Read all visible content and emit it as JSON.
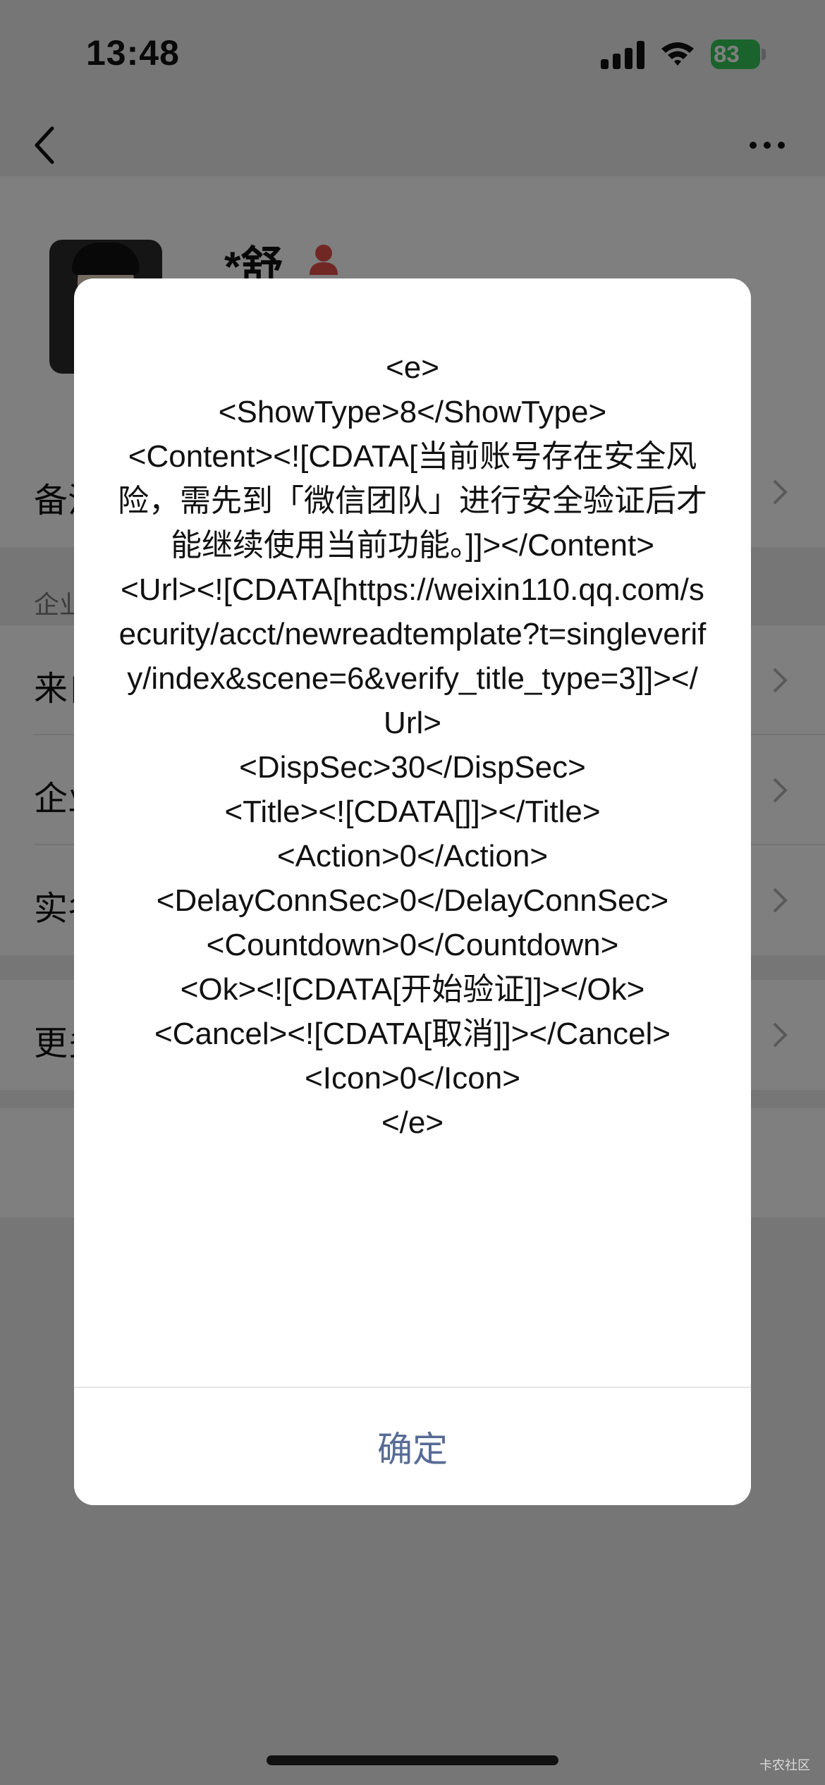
{
  "status_bar": {
    "time": "13:48",
    "battery": "83"
  },
  "profile": {
    "name": "*舒"
  },
  "rows": [
    {
      "label": "备注"
    },
    {
      "label": "来自"
    },
    {
      "label": "企业"
    },
    {
      "label": "实名"
    },
    {
      "label": "更多"
    }
  ],
  "section_header": "企业",
  "dialog": {
    "message": "<e>\n<ShowType>8</ShowType>\n<Content><![CDATA[当前账号存在安全风险，需先到「微信团队」进行安全验证后才能继续使用当前功能。]]></Content>\n<Url><![CDATA[https://weixin110.qq.com/security/acct/newreadtemplate?t=singleverify/index&scene=6&verify_title_type=3]]></Url>\n<DispSec>30</DispSec>\n<Title><![CDATA[]]></Title>\n<Action>0</Action>\n<DelayConnSec>0</DelayConnSec>\n<Countdown>0</Countdown>\n<Ok><![CDATA[开始验证]]></Ok>\n<Cancel><![CDATA[取消]]></Cancel>\n<Icon>0</Icon>\n</e>",
    "confirm_label": "确定"
  },
  "watermark": "卡农社区",
  "colors": {
    "link_blue": "#576b95",
    "battery_green": "#34c759",
    "overlay": "rgba(0,0,0,0.5)"
  }
}
